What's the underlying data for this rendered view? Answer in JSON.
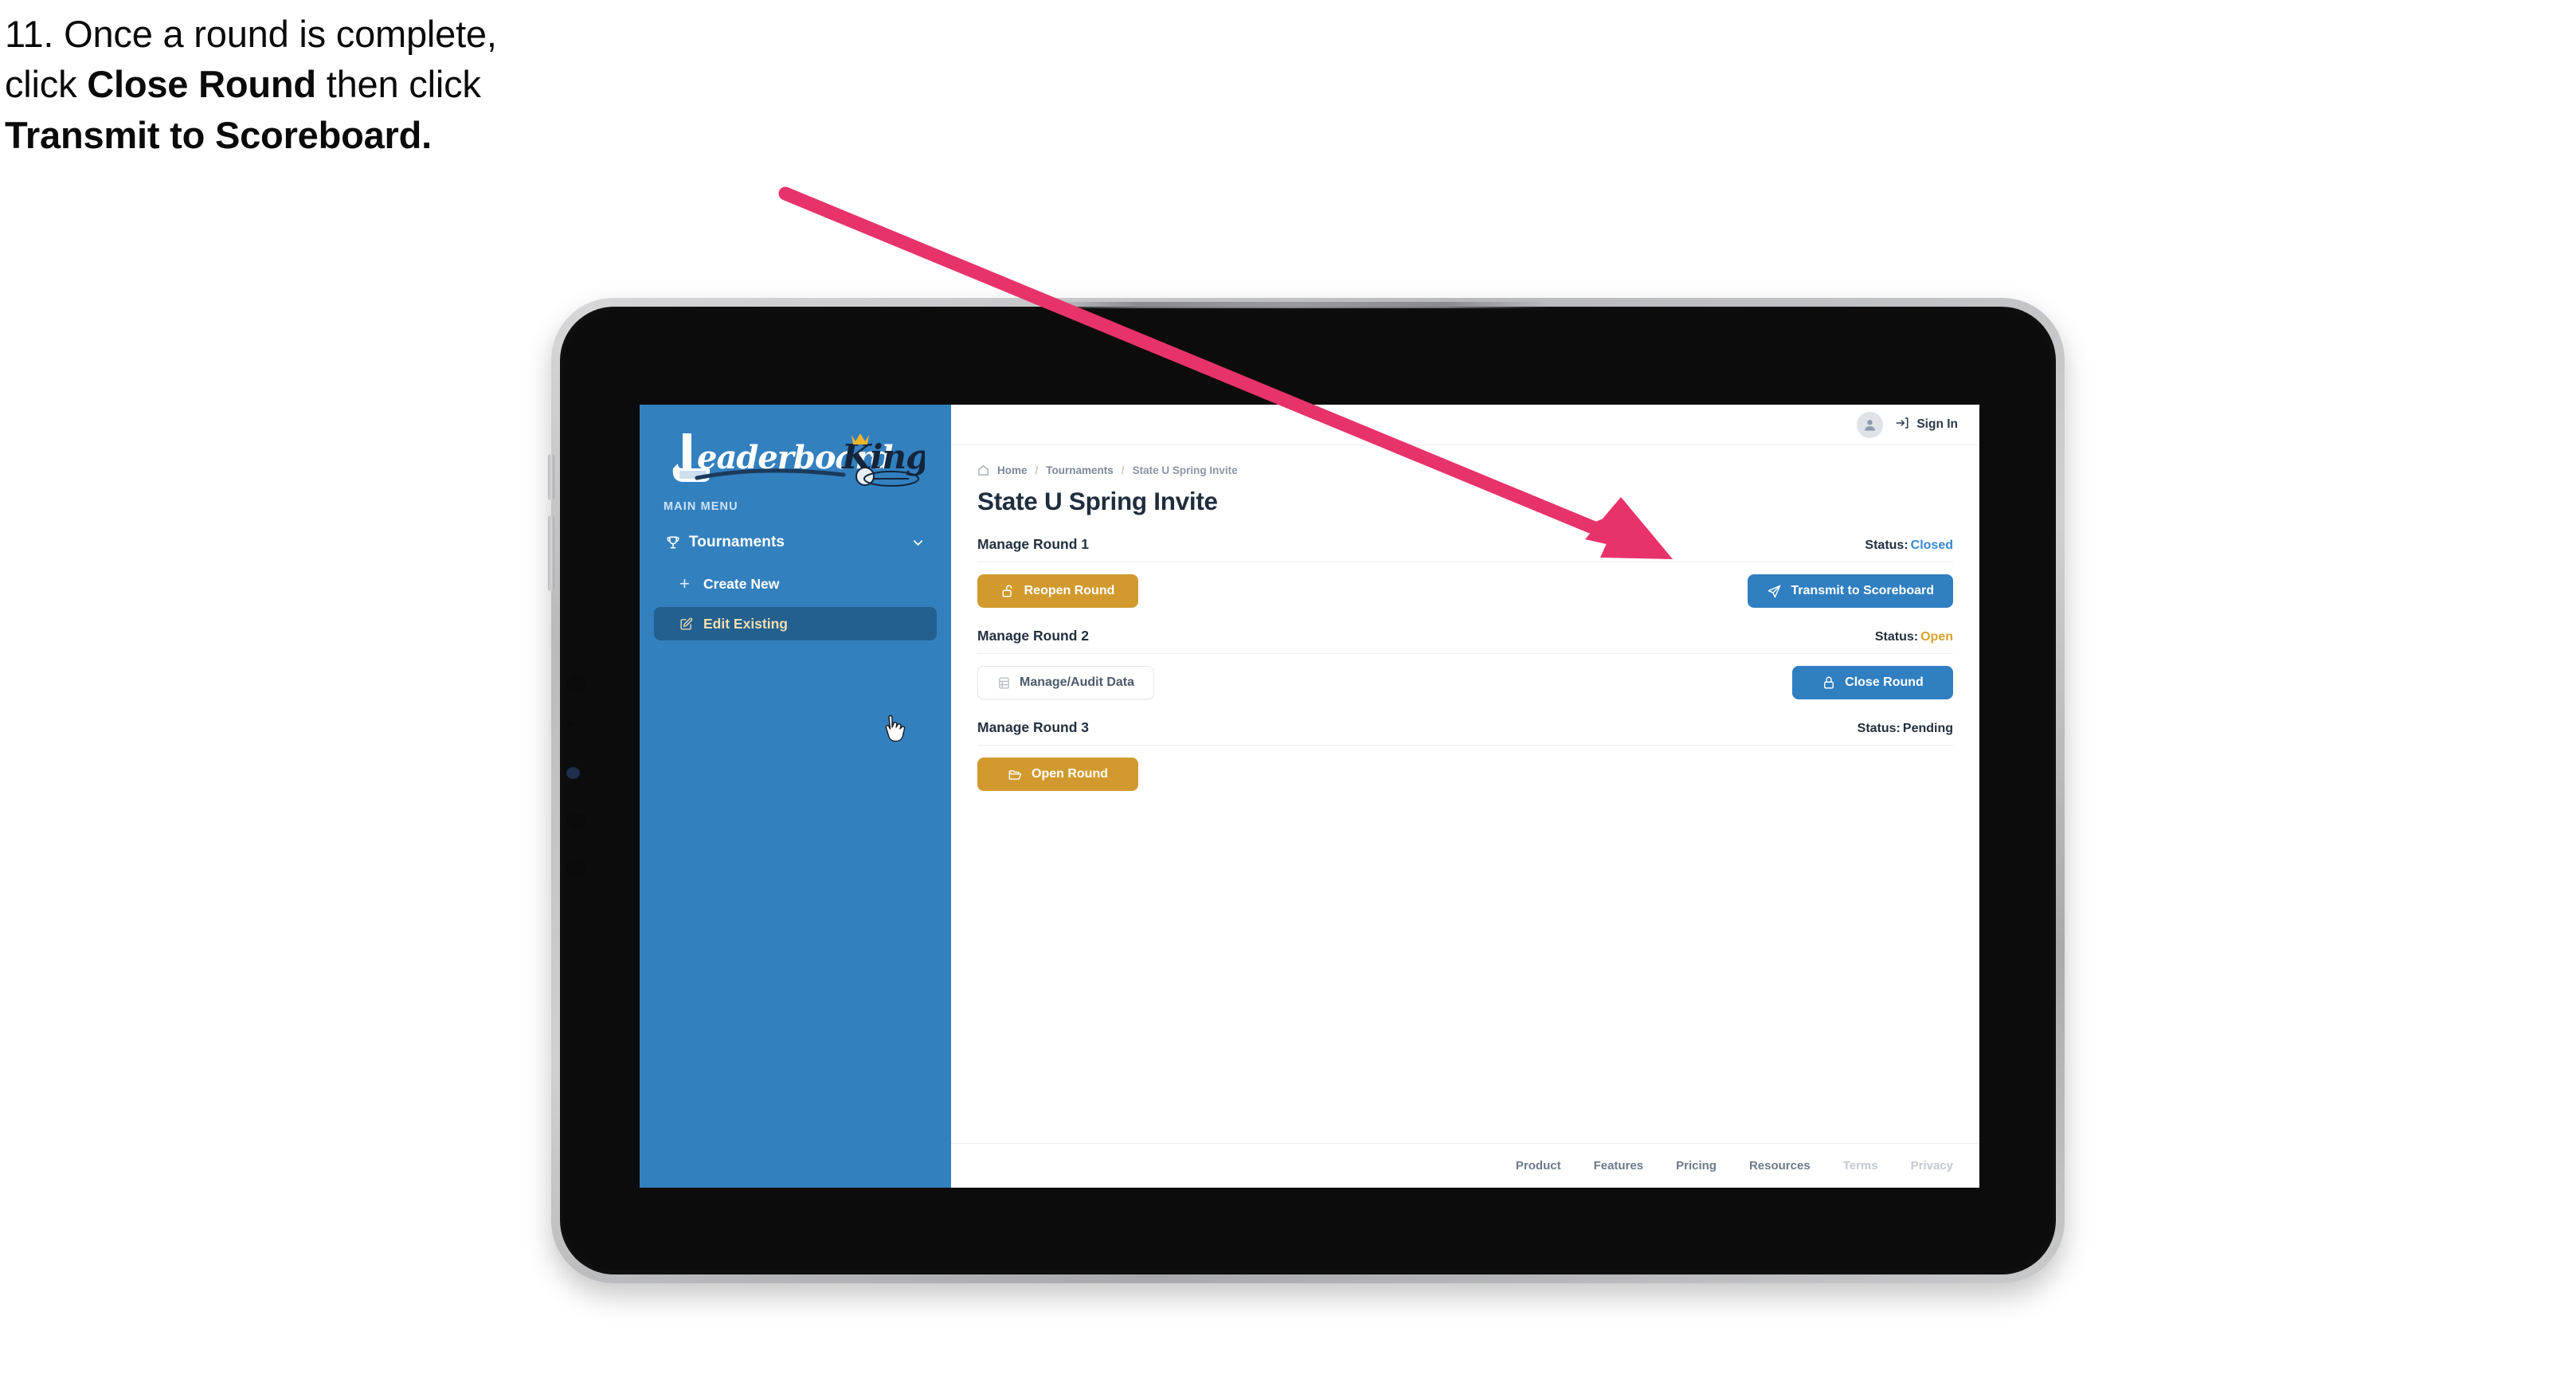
{
  "caption": {
    "line1": "11. Once a round is complete,",
    "line2_a": "click ",
    "line2_b": "Close Round",
    "line2_c": " then click",
    "line3": "Transmit to Scoreboard."
  },
  "colors": {
    "sidebar_blue": "#3380bf",
    "sidebar_active": "#23608f",
    "gold": "#d29a2e",
    "blue": "#2f7fc1",
    "status_closed": "#3a86d0",
    "status_open": "#d9a12e",
    "arrow_pink": "#e8336a"
  },
  "sidebar": {
    "logo": {
      "word1": "Leaderboard",
      "word2": "King"
    },
    "section_label": "MAIN MENU",
    "items": [
      {
        "label": "Tournaments",
        "icon": "trophy-icon",
        "chevron": "chevron-down-icon"
      },
      {
        "label": "Create New",
        "icon": "plus-icon"
      },
      {
        "label": "Edit Existing",
        "icon": "edit-pencil-icon",
        "active": true
      }
    ]
  },
  "topbar": {
    "avatar_icon": "user-avatar-icon",
    "signin_icon": "sign-in-arrow-icon",
    "signin_label": "Sign In"
  },
  "breadcrumb": {
    "home_icon": "home-icon",
    "items": [
      "Home",
      "Tournaments",
      "State U Spring Invite"
    ],
    "separator": "/"
  },
  "page": {
    "title": "State U Spring Invite"
  },
  "rounds": [
    {
      "name": "Manage Round 1",
      "status_label": "Status:",
      "status_value": "Closed",
      "status_class": "st-closed",
      "left_button": {
        "label": "Reopen Round",
        "icon": "unlock-icon",
        "style": "btn-gold"
      },
      "right_button": {
        "label": "Transmit to Scoreboard",
        "icon": "paper-plane-icon",
        "style": "btn-blue"
      }
    },
    {
      "name": "Manage Round 2",
      "status_label": "Status:",
      "status_value": "Open",
      "status_class": "st-open",
      "left_button": {
        "label": "Manage/Audit Data",
        "icon": "table-grid-icon",
        "style": "btn-ghost"
      },
      "right_button": {
        "label": "Close Round",
        "icon": "lock-icon",
        "style": "btn-blue"
      }
    },
    {
      "name": "Manage Round 3",
      "status_label": "Status:",
      "status_value": "Pending",
      "status_class": "st-pending",
      "left_button": {
        "label": "Open Round",
        "icon": "open-folder-icon",
        "style": "btn-gold"
      },
      "right_button": null
    }
  ],
  "footer": {
    "links": [
      {
        "label": "Product",
        "dim": false
      },
      {
        "label": "Features",
        "dim": false
      },
      {
        "label": "Pricing",
        "dim": false
      },
      {
        "label": "Resources",
        "dim": false
      },
      {
        "label": "Terms",
        "dim": true
      },
      {
        "label": "Privacy",
        "dim": true
      }
    ]
  }
}
